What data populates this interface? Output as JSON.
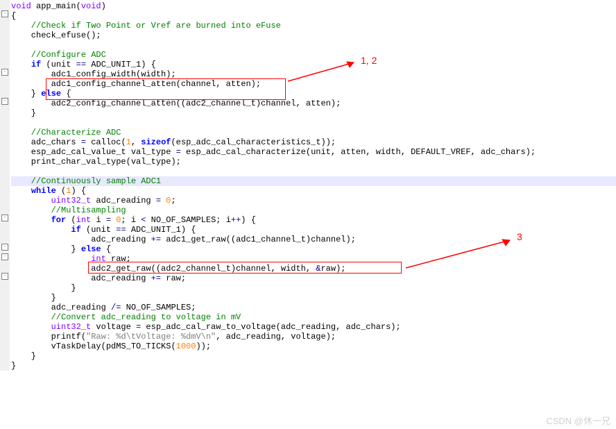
{
  "code": {
    "l1": {
      "kw": "void",
      "sp": " ",
      "fn": "app_main",
      "args": "(",
      "kw2": "void",
      "close": ")"
    },
    "l2": "{",
    "l3": "    //Check if Two Point or Vref are burned into eFuse",
    "l4a": "    check_efuse",
    "l4b": "();",
    "l6": "    //Configure ADC",
    "l7a": "    ",
    "l7if": "if",
    "l7b": " (unit ",
    "l7eq": "==",
    "l7c": " ADC_UNIT_1) {",
    "l8a": "        adc1_config_width",
    "l8b": "(width);",
    "l9a": "        adc1_config_channel_atten",
    "l9b": "(channel, atten);",
    "l10a": "    } ",
    "l10e": "else",
    "l10b": " {",
    "l11a": "        adc2_config_channel_atten",
    "l11b": "((adc2_channel_t)channel, atten);",
    "l12": "    }",
    "l14": "    //Characterize ADC",
    "l15a": "    adc_chars ",
    "l15eq": "=",
    "l15b": " calloc",
    "l15c": "(",
    "l15n": "1",
    "l15d": ", ",
    "l15sz": "sizeof",
    "l15e": "(esp_adc_cal_characteristics_t));",
    "l16a": "    esp_adc_cal_value_t val_type ",
    "l16eq": "=",
    "l16b": " esp_adc_cal_characterize",
    "l16c": "(unit, atten, width, DEFAULT_VREF, adc_chars);",
    "l17a": "    print_char_val_type",
    "l17b": "(val_type);",
    "l19": "    //Continuously sample ADC1",
    "l20a": "    ",
    "l20w": "while",
    "l20b": " (",
    "l20n": "1",
    "l20c": ") {",
    "l21a": "        ",
    "l21t": "uint32_t",
    "l21b": " adc_reading ",
    "l21eq": "=",
    "l21c": " ",
    "l21n": "0",
    "l21d": ";",
    "l22": "        //Multisampling",
    "l23a": "        ",
    "l23f": "for",
    "l23b": " (",
    "l23t": "int",
    "l23c": " i ",
    "l23eq": "=",
    "l23d": " ",
    "l23n": "0",
    "l23e": "; i ",
    "l23lt": "<",
    "l23g": " NO_OF_SAMPLES; i",
    "l23pp": "++",
    "l23h": ") {",
    "l24a": "            ",
    "l24if": "if",
    "l24b": " (unit ",
    "l24eq": "==",
    "l24c": " ADC_UNIT_1) {",
    "l25a": "                adc_reading ",
    "l25pe": "+=",
    "l25b": " adc1_get_raw",
    "l25c": "((adc1_channel_t)channel);",
    "l26a": "            } ",
    "l26e": "else",
    "l26b": " {",
    "l27a": "                ",
    "l27t": "int",
    "l27b": " raw;",
    "l28a": "                adc2_get_raw",
    "l28b": "((adc2_channel_t)channel, width, ",
    "l28amp": "&",
    "l28c": "raw);",
    "l29a": "                adc_reading ",
    "l29pe": "+=",
    "l29b": " raw;",
    "l30": "            }",
    "l31": "        }",
    "l32a": "        adc_reading ",
    "l32de": "/=",
    "l32b": " NO_OF_SAMPLES;",
    "l33": "        //Convert adc_reading to voltage in mV",
    "l34a": "        ",
    "l34t": "uint32_t",
    "l34b": " voltage ",
    "l34eq": "=",
    "l34c": " esp_adc_cal_raw_to_voltage",
    "l34d": "(adc_reading, adc_chars);",
    "l35a": "        printf",
    "l35b": "(",
    "l35s": "\"Raw: %d\\tVoltage: %dmV\\n\"",
    "l35c": ", adc_reading, voltage);",
    "l36a": "        vTaskDelay",
    "l36b": "(pdMS_TO_TICKS(",
    "l36n": "1000",
    "l36c": "));",
    "l37": "    }",
    "l38": "}"
  },
  "annotations": {
    "a1": "1, 2",
    "a2": "3"
  },
  "watermark": "CSDN @休一兄"
}
